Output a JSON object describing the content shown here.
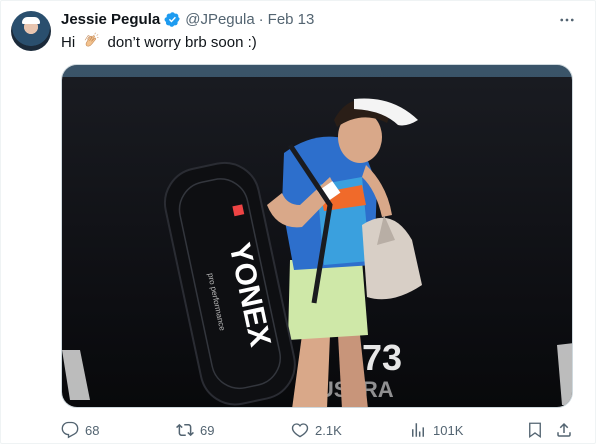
{
  "tweet": {
    "author_name": "Jessie Pegula",
    "handle": "@JPegula",
    "separator": "·",
    "date": "Feb 13",
    "text_before": "Hi",
    "text_after": "don’t worry brb soon :)",
    "emoji": "clapping-hands"
  },
  "media": {
    "bag_text": "YONEX",
    "bag_subtext": "pro performance",
    "background_text_1": "73",
    "background_text_2": "AUSTRA"
  },
  "actions": {
    "replies": "68",
    "reposts": "69",
    "likes": "2.1K",
    "views": "101K"
  },
  "colors": {
    "verified": "#1d9bf0",
    "muted": "#536471",
    "text": "#0f1419"
  }
}
